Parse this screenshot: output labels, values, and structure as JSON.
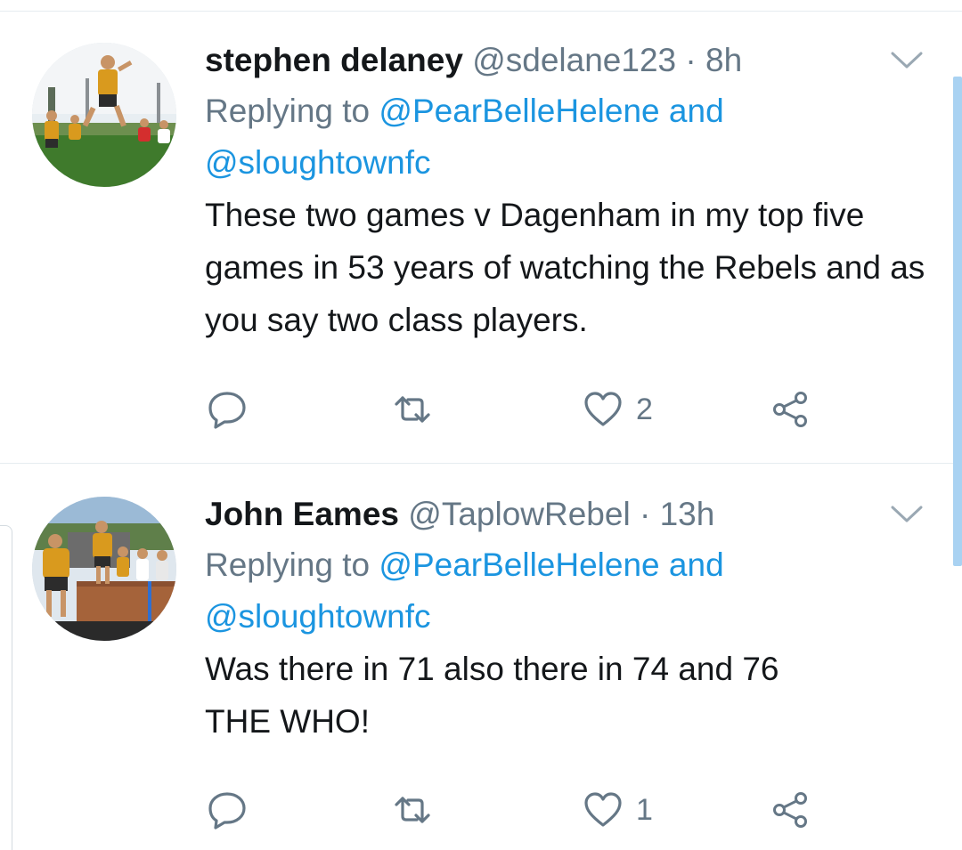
{
  "tweets": [
    {
      "name": "stephen delaney",
      "handle": "@sdelane123",
      "dot": " · ",
      "time": "8h",
      "replying_prefix": "Replying to ",
      "mention_1": "@PearBelleHelene",
      "and_word": " and",
      "mention_2": "@sloughtownfc",
      "text": "These two games v Dagenham in my top five  games in 53 years of watching the Rebels and as you say two class players.",
      "like_count": "2"
    },
    {
      "name": "John Eames",
      "handle": "@TaplowRebel",
      "dot": " · ",
      "time": "13h",
      "replying_prefix": "Replying to ",
      "mention_1": "@PearBelleHelene",
      "and_word": " and",
      "mention_2": "@sloughtownfc",
      "text_line1": "Was there in 71 also there in 74 and 76",
      "text_line2": "THE WHO!",
      "like_count": "1"
    }
  ],
  "icons": {
    "reply": "reply-icon",
    "retweet": "retweet-icon",
    "like": "heart-icon",
    "share": "share-icon",
    "caret": "chevron-down-icon"
  },
  "colors": {
    "mention_blue": "#1b95e0",
    "secondary_gray": "#657786",
    "text_black": "#14171a"
  }
}
